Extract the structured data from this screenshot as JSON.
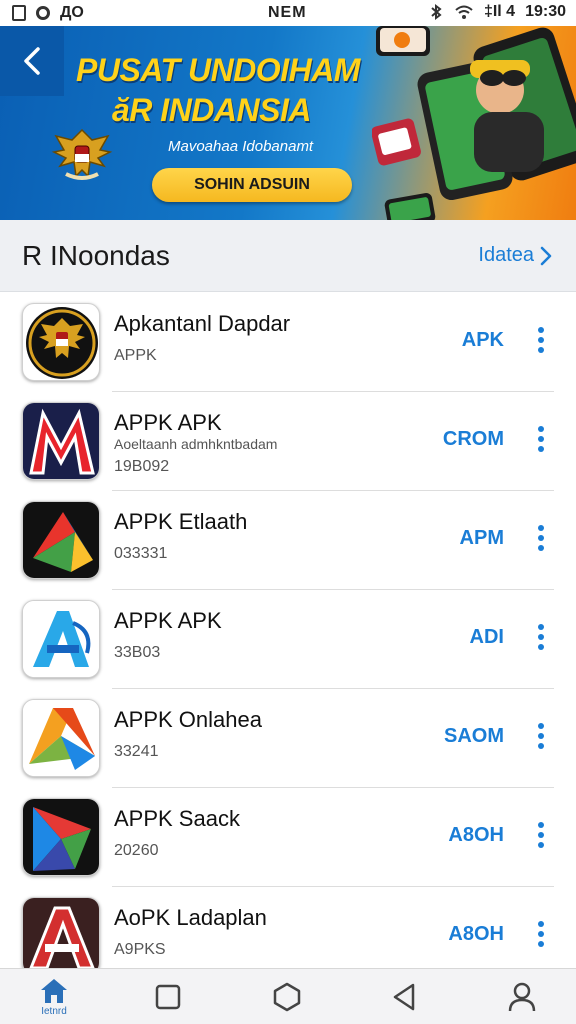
{
  "status_bar": {
    "left_text": "ДО",
    "center_text": "NEM",
    "signal_text": "‡Il 4",
    "time": "19:30"
  },
  "banner": {
    "title_line1": "PUSAT UNDOIHAM",
    "title_line2": "ăR INDANSIA",
    "subtitle": "Mavoahaa Idobanamt",
    "cta_label": "SOHIN ADSUIN"
  },
  "section": {
    "title": "R INoondas",
    "link_label": "Idatea"
  },
  "apps": [
    {
      "name": "Apkantanl Dapdar",
      "description": "",
      "meta": "APPK",
      "action": "APK",
      "icon": "garuda-emblem-icon"
    },
    {
      "name": "APPK APK",
      "description": "Aoeltaanh admhkntbadam",
      "meta": "19B092",
      "action": "CROM",
      "icon": "red-m-logo-icon"
    },
    {
      "name": "APPK Etlaath",
      "description": "",
      "meta": "033331",
      "action": "APM",
      "icon": "colorful-a-logo-icon"
    },
    {
      "name": "APPK APK",
      "description": "",
      "meta": "33B03",
      "action": "ADI",
      "icon": "blue-a-logo-icon"
    },
    {
      "name": "APPK Onlahea",
      "description": "",
      "meta": "33241",
      "action": "SAOM",
      "icon": "play-triangle-logo-icon"
    },
    {
      "name": "APPK Saack",
      "description": "",
      "meta": "20260",
      "action": "A8OH",
      "icon": "multicolor-play-logo-icon"
    },
    {
      "name": "AoPK Ladaplan",
      "description": "",
      "meta": "A9PKS",
      "action": "A8OH",
      "icon": "red-a-logo-icon"
    }
  ],
  "nav": {
    "home_label": "Ietnrd",
    "items": [
      "home-icon",
      "square-icon",
      "hexagon-icon",
      "back-triangle-icon",
      "profile-icon"
    ]
  },
  "colors": {
    "accent": "#1a7dd6",
    "banner_blue": "#0a5fb4",
    "banner_orange": "#f07d10",
    "banner_yellow": "#ffd21a"
  }
}
